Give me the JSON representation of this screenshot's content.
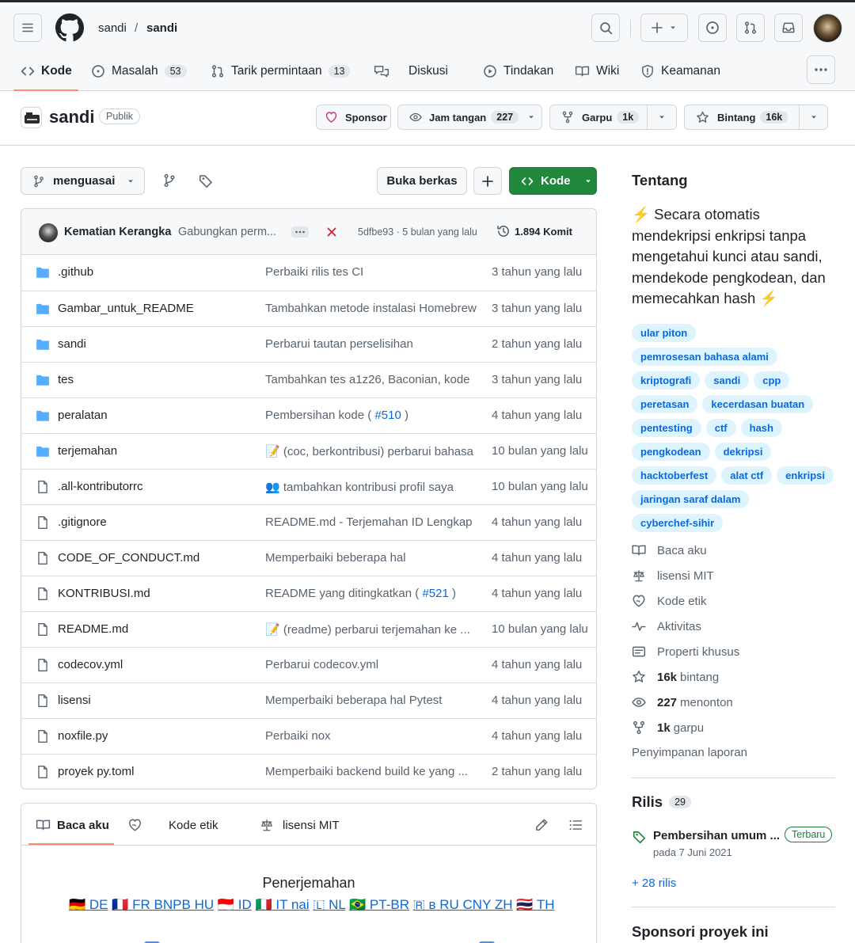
{
  "header": {
    "owner": "sandi",
    "separator": "/",
    "repo": "sandi"
  },
  "nav": {
    "code": "Kode",
    "issues": "Masalah",
    "issues_count": "53",
    "pulls": "Tarik permintaan",
    "pulls_count": "13",
    "discussions": "Diskusi",
    "actions": "Tindakan",
    "wiki": "Wiki",
    "security": "Keamanan"
  },
  "repo": {
    "name": "sandi",
    "visibility": "Publik",
    "sponsor": "Sponsor",
    "watch": "Jam tangan",
    "watch_count": "227",
    "fork": "Garpu",
    "fork_count": "1k",
    "star": "Bintang",
    "star_count": "16k"
  },
  "toolbar": {
    "branch": "menguasai",
    "open_file": "Buka berkas",
    "code_button": "Kode"
  },
  "commit": {
    "author": "Kematian Kerangka",
    "message": "Gabungkan perm...",
    "hash_time": "5dfbe93 · 5 bulan yang lalu",
    "commits": "1.894 Komit"
  },
  "files": [
    {
      "type": "dir",
      "name": ".github",
      "msg": "Perbaiki rilis tes CI",
      "link": "",
      "msg_end": "",
      "date": "3 tahun yang lalu"
    },
    {
      "type": "dir",
      "name": "Gambar_untuk_README",
      "msg": "Tambahkan metode instalasi Homebrew",
      "link": "",
      "msg_end": "",
      "date": "3 tahun yang lalu"
    },
    {
      "type": "dir",
      "name": "sandi",
      "msg": "Perbarui tautan perselisihan",
      "link": "",
      "msg_end": "",
      "date": "2 tahun yang lalu"
    },
    {
      "type": "dir",
      "name": "tes",
      "msg": "Tambahkan tes a1z26, Baconian, kode",
      "link": "",
      "msg_end": "",
      "date": "3 tahun yang lalu"
    },
    {
      "type": "dir",
      "name": "peralatan",
      "msg": "Pembersihan kode (",
      "link": "#510",
      "msg_end": ")",
      "date": "4 tahun yang lalu"
    },
    {
      "type": "dir",
      "name": "terjemahan",
      "msg": "📝 (coc, berkontribusi) perbarui bahasa",
      "link": "",
      "msg_end": "",
      "date": "10 bulan yang lalu"
    },
    {
      "type": "file",
      "name": ".all-kontributorrc",
      "msg": "👥 tambahkan kontribusi profil saya",
      "link": "",
      "msg_end": "",
      "date": "10 bulan yang lalu"
    },
    {
      "type": "file",
      "name": ".gitignore",
      "msg": "README.md - Terjemahan ID Lengkap",
      "link": "",
      "msg_end": "",
      "date": "4 tahun yang lalu"
    },
    {
      "type": "file",
      "name": "CODE_OF_CONDUCT.md",
      "msg": "Memperbaiki beberapa hal",
      "link": "",
      "msg_end": "",
      "date": "4 tahun yang lalu"
    },
    {
      "type": "file",
      "name": "KONTRIBUSI.md",
      "msg": "README yang ditingkatkan (",
      "link": "#521",
      "msg_end": ")",
      "date": "4 tahun yang lalu"
    },
    {
      "type": "file",
      "name": "README.md",
      "msg": "📝 (readme) perbarui terjemahan ke ...",
      "link": "",
      "msg_end": "",
      "date": "10 bulan yang lalu"
    },
    {
      "type": "file",
      "name": "codecov.yml",
      "msg": "Perbarui codecov.yml",
      "link": "",
      "msg_end": "",
      "date": "4 tahun yang lalu"
    },
    {
      "type": "file",
      "name": "lisensi",
      "msg": "Memperbaiki beberapa hal Pytest",
      "link": "",
      "msg_end": "",
      "date": "4 tahun yang lalu"
    },
    {
      "type": "file",
      "name": "noxfile.py",
      "msg": "Perbaiki nox",
      "link": "",
      "msg_end": "",
      "date": "4 tahun yang lalu"
    },
    {
      "type": "file",
      "name": "proyek py.toml",
      "msg": "Memperbaiki backend build ke yang ...",
      "link": "",
      "msg_end": "",
      "date": "2 tahun yang lalu"
    }
  ],
  "readme": {
    "tab_readme": "Baca aku",
    "tab_coc": "Kode etik",
    "tab_license": "lisensi MIT",
    "translations_title": "Penerjemahan",
    "languages": [
      {
        "flag": "🇩🇪",
        "code": "DE"
      },
      {
        "flag": "🇫🇷",
        "code": "FR BNPB HU"
      },
      {
        "flag": "🇮🇩",
        "code": "ID"
      },
      {
        "flag": "🇮🇹",
        "code": "IT nai"
      },
      {
        "flag": "🇱",
        "code": "NL"
      },
      {
        "flag": "🇧🇷",
        "code": "PT-BR"
      },
      {
        "flag": "🇷",
        "code": "в RU CNY ZH"
      },
      {
        "flag": "🇹🇭",
        "code": "TH"
      }
    ]
  },
  "about": {
    "title": "Tentang",
    "description": "⚡ Secara otomatis mendekripsi enkripsi tanpa mengetahui kunci atau sandi, mendekode pengkodean, dan memecahkan hash ⚡",
    "topics": [
      "ular piton",
      "pemrosesan bahasa alami",
      "kriptografi",
      "sandi",
      "cpp",
      "peretasan",
      "kecerdasan buatan",
      "pentesting",
      "ctf",
      "hash",
      "pengkodean",
      "dekripsi",
      "hacktoberfest",
      "alat ctf",
      "enkripsi",
      "jaringan saraf dalam",
      "cyberchef-sihir"
    ],
    "readme": "Baca aku",
    "license": "lisensi MIT",
    "coc": "Kode etik",
    "activity": "Aktivitas",
    "custom_props": "Properti khusus",
    "stars_num": "16k",
    "stars_label": "bintang",
    "watch_num": "227",
    "watch_label": "menonton",
    "fork_num": "1k",
    "fork_label": "garpu",
    "report": "Penyimpanan laporan"
  },
  "releases": {
    "title": "Rilis",
    "count": "29",
    "latest_name": "Pembersihan umum ...",
    "latest_badge": "Terbaru",
    "latest_date": "pada 7 Juni 2021",
    "more": "+ 28 rilis"
  },
  "sponsor_section": {
    "title": "Sponsori proyek ini"
  },
  "colors": {
    "accent": "#0969da",
    "green": "#1f883d",
    "nav_underline": "#fd8c73",
    "folder": "#54aeff"
  }
}
